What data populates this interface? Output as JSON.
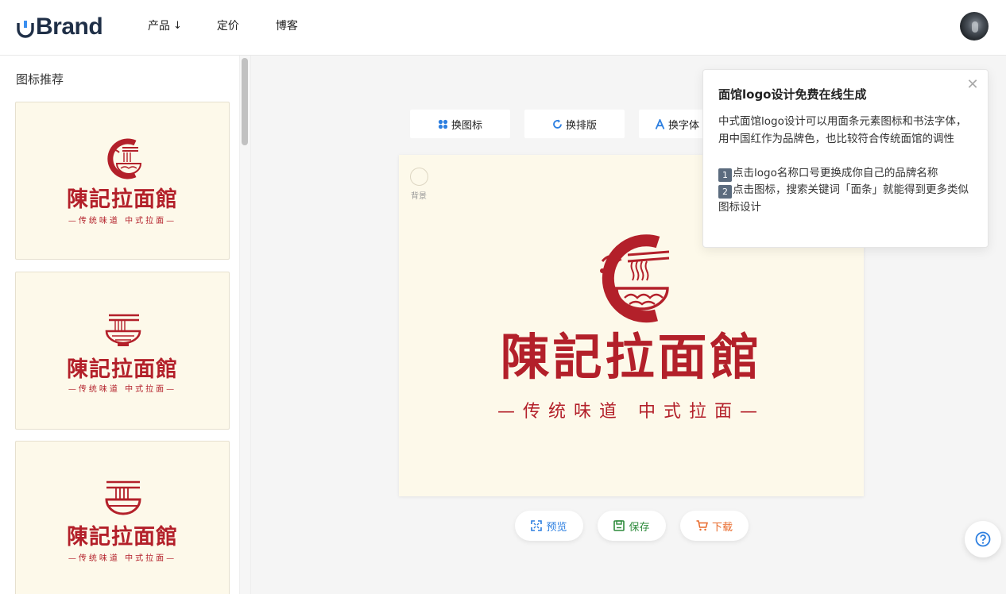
{
  "header": {
    "brand": "Brand",
    "nav": [
      {
        "label": "产品",
        "arrow": "↓"
      },
      {
        "label": "定价"
      },
      {
        "label": "博客"
      }
    ]
  },
  "sidebar": {
    "title": "图标推荐",
    "cards": [
      {
        "brand": "陳記拉面館",
        "slogan": "—传统味道  中式拉面—",
        "icon": "noodle-bowl-swirl-icon"
      },
      {
        "brand": "陳記拉面館",
        "slogan": "—传统味道  中式拉面—",
        "icon": "noodle-bowl-chopsticks-icon"
      },
      {
        "brand": "陳記拉面館",
        "slogan": "—传统味道  中式拉面—",
        "icon": "noodle-bowl-outline-icon"
      }
    ]
  },
  "toolbar": {
    "change_icon": "换图标",
    "change_layout": "换排版",
    "change_font": "换字体"
  },
  "stage": {
    "background_label": "背景",
    "brand": "陳記拉面館",
    "slogan": "—传统味道  中式拉面—",
    "background_color": "#fdf9ea",
    "brand_color": "#b3202a"
  },
  "actions": {
    "preview": "预览",
    "save": "保存",
    "download": "下载"
  },
  "tip": {
    "title": "面馆logo设计免费在线生成",
    "line1": "中式面馆logo设计可以用面条元素图标和书法字体，用中国红作为品牌色，也比较符合传统面馆的调性",
    "step1_num": "1",
    "step1": "点击logo名称口号更换成你自己的品牌名称",
    "step2_num": "2",
    "step2": "点击图标，搜索关键词「面条」就能得到更多类似图标设计"
  }
}
